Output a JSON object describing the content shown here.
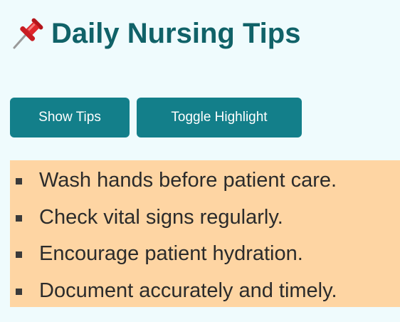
{
  "header": {
    "title": "Daily Nursing Tips",
    "icon": "pushpin-icon"
  },
  "buttons": {
    "show_label": "Show Tips",
    "toggle_label": "Toggle Highlight"
  },
  "tips": [
    "Wash hands before patient care.",
    "Check vital signs regularly.",
    "Encourage patient hydration.",
    "Document accurately and timely."
  ],
  "colors": {
    "page_background": "#effbfd",
    "title": "#106268",
    "button": "#137f8a",
    "highlight": "#fed5a3"
  }
}
